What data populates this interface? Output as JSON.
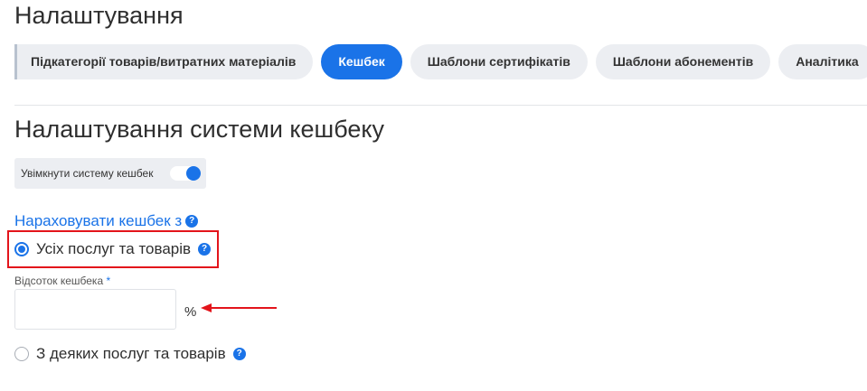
{
  "page": {
    "title": "Налаштування"
  },
  "tabs": [
    {
      "label": "Підкатегорії товарів/витратних матеріалів",
      "active": false
    },
    {
      "label": "Кешбек",
      "active": true
    },
    {
      "label": "Шаблони сертифікатів",
      "active": false
    },
    {
      "label": "Шаблони абонементів",
      "active": false
    },
    {
      "label": "Аналітика",
      "active": false
    }
  ],
  "cashback": {
    "title": "Налаштування системи кешбеку",
    "toggle_label": "Увімкнути систему кешбек",
    "toggle_on": true,
    "charge_from_title": "Нараховувати кешбек з",
    "option_all": "Усіх послуг та товарів",
    "option_all_selected": true,
    "percent_label": "Відсоток кешбека",
    "percent_required_mark": "*",
    "percent_value": "",
    "percent_unit": "%",
    "option_some": "З деяких послуг та товарів",
    "option_some_selected": false
  },
  "icons": {
    "help": "?"
  },
  "colors": {
    "accent": "#1a73e8",
    "annotation": "#e3141b",
    "tab_bg": "#eceef2"
  }
}
